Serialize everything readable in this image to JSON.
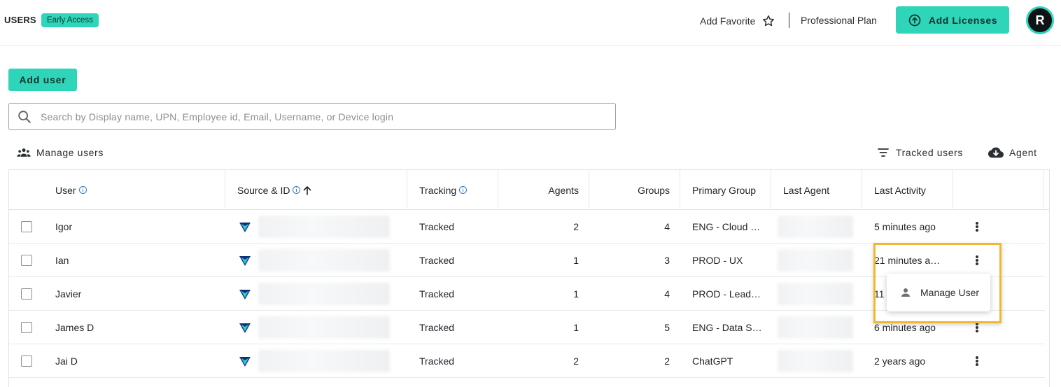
{
  "header": {
    "title": "USERS",
    "badge": "Early Access",
    "add_favorite": "Add Favorite",
    "plan": "Professional Plan",
    "add_licenses": "Add Licenses",
    "avatar_initial": "R",
    "accent_color": "#2fd5b9"
  },
  "actions": {
    "add_user": "Add user",
    "search_placeholder": "Search by Display name, UPN, Employee id, Email, Username, or Device login",
    "manage_users": "Manage users",
    "tracked_users": "Tracked users",
    "agent": "Agent"
  },
  "table": {
    "columns": [
      "User",
      "Source & ID",
      "Tracking",
      "Agents",
      "Groups",
      "Primary Group",
      "Last Agent",
      "Last Activity"
    ],
    "rows": [
      {
        "user": "Igor",
        "tracking": "Tracked",
        "agents": "2",
        "groups": "4",
        "primary_group": "ENG - Cloud …",
        "last_activity": "5 minutes ago"
      },
      {
        "user": "Ian",
        "tracking": "Tracked",
        "agents": "1",
        "groups": "3",
        "primary_group": "PROD - UX",
        "last_activity": "21 minutes a…"
      },
      {
        "user": "Javier",
        "tracking": "Tracked",
        "agents": "1",
        "groups": "4",
        "primary_group": "PROD - Lead…",
        "last_activity": "11"
      },
      {
        "user": "James D",
        "tracking": "Tracked",
        "agents": "1",
        "groups": "5",
        "primary_group": "ENG - Data S…",
        "last_activity": "6 minutes ago"
      },
      {
        "user": "Jai D",
        "tracking": "Tracked",
        "agents": "2",
        "groups": "2",
        "primary_group": "ChatGPT",
        "last_activity": "2 years ago"
      }
    ]
  },
  "context_menu": {
    "item": "Manage User",
    "highlight_color": "#f2b632"
  },
  "icons": [
    "star-icon",
    "upload-circle-icon",
    "search-icon",
    "group-icon",
    "filter-icon",
    "cloud-download-icon",
    "info-icon",
    "arrow-up-icon",
    "source-logo-icon",
    "kebab-menu-icon",
    "person-icon"
  ]
}
